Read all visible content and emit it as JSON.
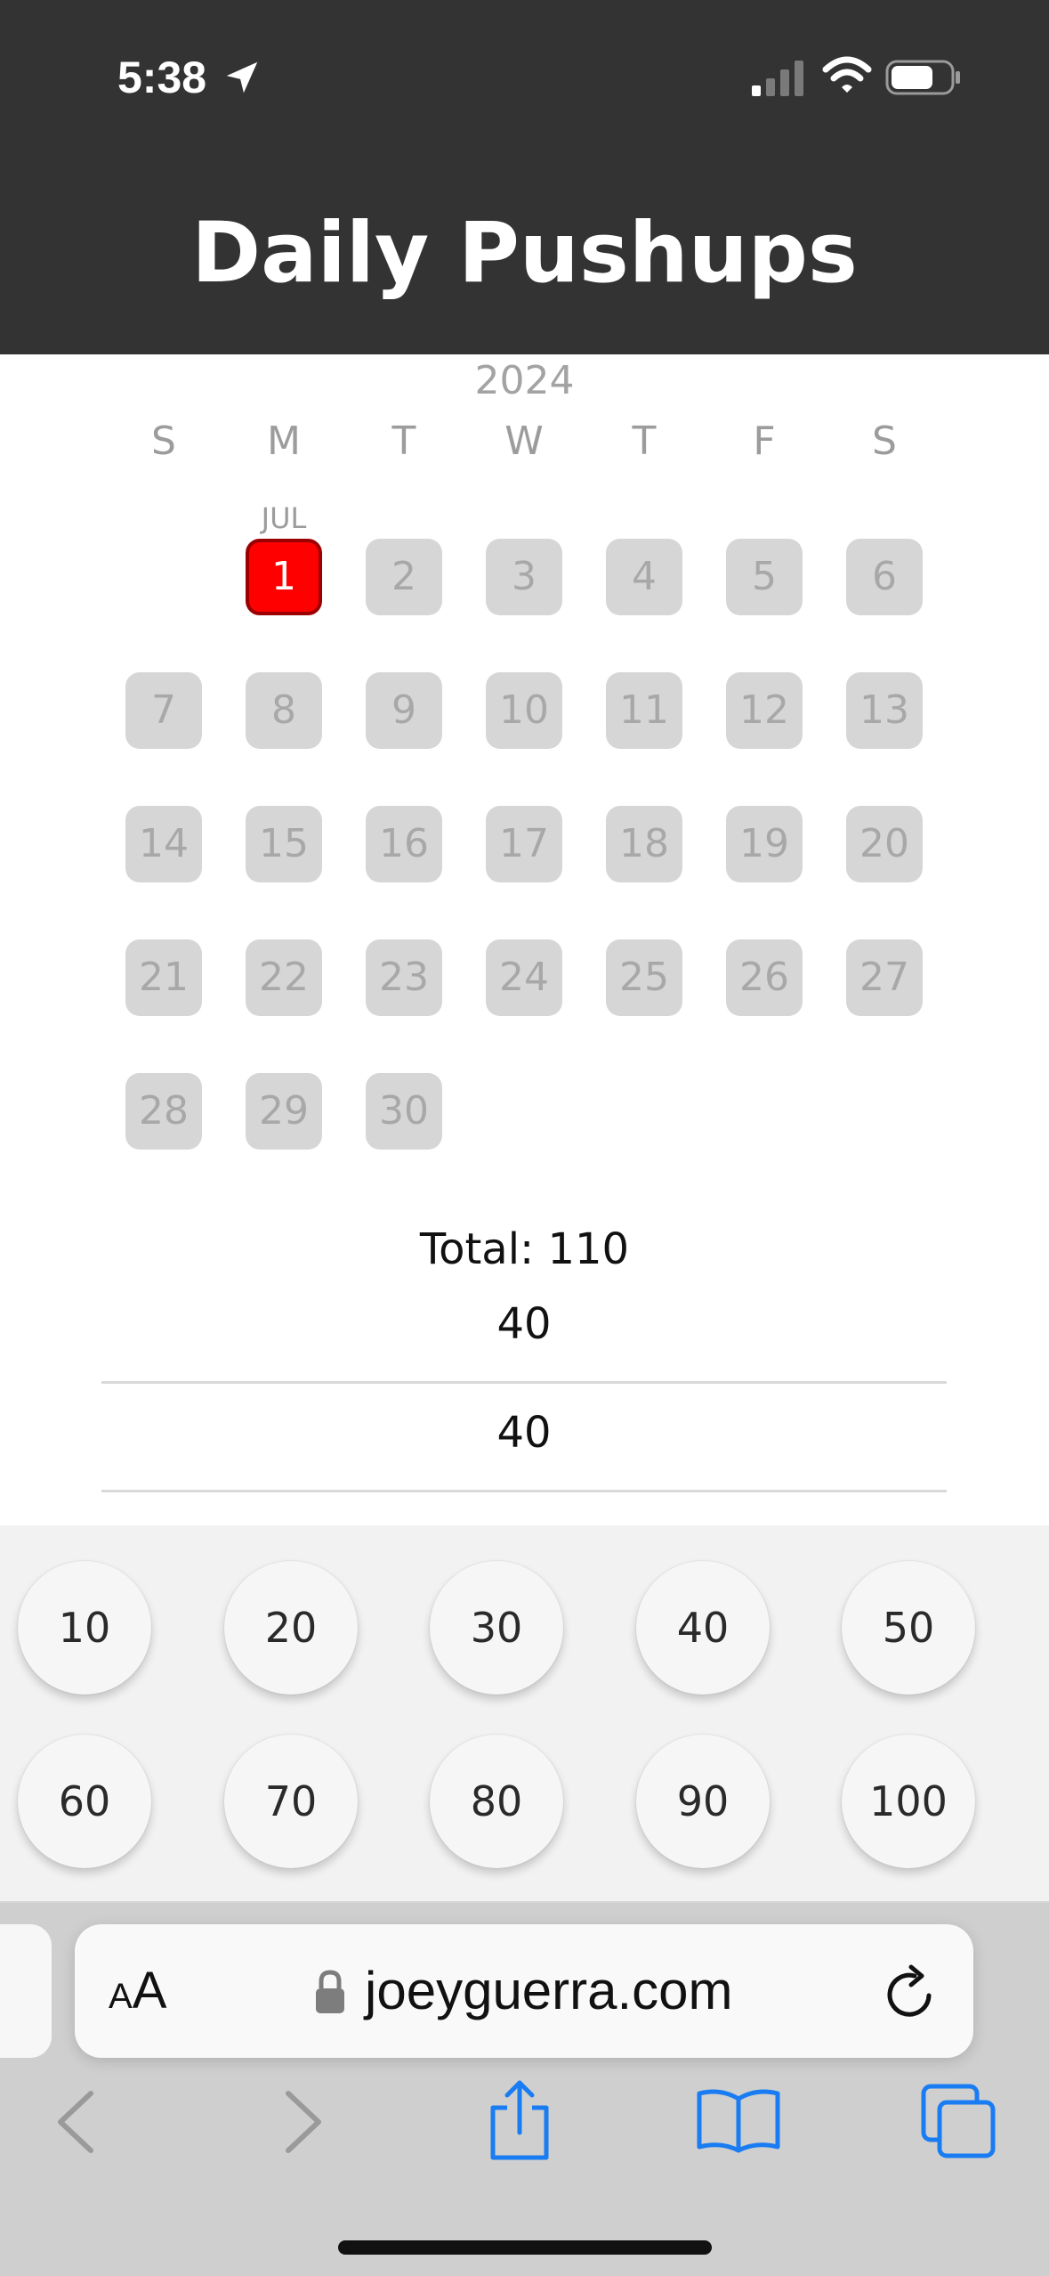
{
  "status_bar": {
    "time": "5:38"
  },
  "app": {
    "title": "Daily Pushups"
  },
  "calendar": {
    "year": "2024",
    "month_label": "JUL",
    "weekdays": [
      "S",
      "M",
      "T",
      "W",
      "T",
      "F",
      "S"
    ],
    "days": [
      "1",
      "2",
      "3",
      "4",
      "5",
      "6",
      "7",
      "8",
      "9",
      "10",
      "11",
      "12",
      "13",
      "14",
      "15",
      "16",
      "17",
      "18",
      "19",
      "20",
      "21",
      "22",
      "23",
      "24",
      "25",
      "26",
      "27",
      "28",
      "29",
      "30"
    ],
    "selected_day": "1"
  },
  "summary": {
    "total": "Total: 110"
  },
  "entries": [
    "40",
    "40"
  ],
  "quick_add": [
    "10",
    "20",
    "30",
    "40",
    "50",
    "60",
    "70",
    "80",
    "90",
    "100"
  ],
  "browser": {
    "aa_small": "A",
    "aa_big": "A",
    "url": "joeyguerra.com"
  },
  "colors": {
    "header_bg": "#333333",
    "selected_day": "#ff0000",
    "inactive_day": "#d6d6d6",
    "safari_accent": "#1a7cf2"
  }
}
